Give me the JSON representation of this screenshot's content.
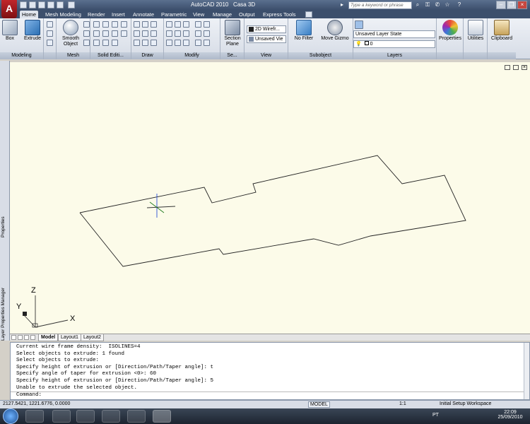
{
  "window": {
    "title": "AutoCAD 2010",
    "document": "Casa 3D",
    "search_placeholder": "Type a keyword or phrase"
  },
  "app_logo": "A",
  "ribbon_tabs": [
    {
      "label": "Home",
      "active": true
    },
    {
      "label": "Mesh Modeling",
      "active": false
    },
    {
      "label": "Render",
      "active": false
    },
    {
      "label": "Insert",
      "active": false
    },
    {
      "label": "Annotate",
      "active": false
    },
    {
      "label": "Parametric",
      "active": false
    },
    {
      "label": "View",
      "active": false
    },
    {
      "label": "Manage",
      "active": false
    },
    {
      "label": "Output",
      "active": false
    },
    {
      "label": "Express Tools",
      "active": false
    }
  ],
  "panels": {
    "modeling": "Modeling",
    "mesh": "Mesh",
    "solid_editing": "Solid Editi...",
    "draw": "Draw",
    "modify": "Modify",
    "section": "Se...",
    "view": "View",
    "subobject": "Subobject",
    "layers": "Layers"
  },
  "buttons": {
    "box": "Box",
    "extrude": "Extrude",
    "smooth_object": [
      "Smooth",
      "Object"
    ],
    "section_plane": [
      "Section",
      "Plane"
    ],
    "no_filter": "No Filter",
    "move_gizmo": "Move Gizmo",
    "properties": "Properties",
    "utilities": "Utilities",
    "clipboard": "Clipboard"
  },
  "dropdowns": {
    "visual_style": "2D Wirefr...",
    "saved_view": "Unsaved Vie",
    "layer_state": "Unsaved Layer State",
    "current_layer": "0"
  },
  "ucs": {
    "x": "X",
    "y": "Y",
    "z": "Z"
  },
  "side_palettes": [
    "Properties",
    "Layer Properties Manager"
  ],
  "layout_tabs": [
    {
      "label": "Model",
      "active": true
    },
    {
      "label": "Layout1",
      "active": false
    },
    {
      "label": "Layout2",
      "active": false
    }
  ],
  "command_history": [
    "Current wire frame density:  ISOLINES=4",
    "Select objects to extrude: 1 found",
    "Select objects to extrude:",
    "Specify height of extrusion or [Direction/Path/Taper angle]: t",
    "Specify angle of taper for extrusion <0>: 60",
    "Specify height of extrusion or [Direction/Path/Taper angle]: 5",
    "Unable to extrude the selected object."
  ],
  "command_prompt": "Command:",
  "status": {
    "coordinates": "2127.5421, 1221.6776, 0.0000",
    "model": "MODEL",
    "scale": "1:1",
    "workspace": "Initial Setup Workspace"
  },
  "taskbar": {
    "language": "PT",
    "time": "22:09",
    "date": "25/09/2010"
  }
}
